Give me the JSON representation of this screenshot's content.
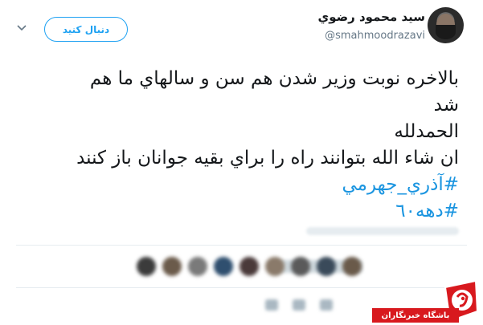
{
  "user": {
    "display_name": "سید محمود رضوي",
    "handle": "@smahmoodrazavi",
    "avatar_icon": "profile-photo"
  },
  "header": {
    "follow_label": "دنبال کنید",
    "caret_icon": "chevron-down-icon"
  },
  "tweet": {
    "line1": "بالاخره نوبت وزير شدن هم سن و سالهاي ما هم",
    "line2": "شد",
    "line3": "الحمدلله",
    "line4": "ان شاء الله بتوانند راه را براي بقيه جوانان باز كنند",
    "hashtag1": "#آذري_جهرمي",
    "hashtag2": "#دهه٦٠"
  },
  "watermark": {
    "label": "باشگاه خبرنگاران",
    "logo_icon": "yjc-logo"
  },
  "colors": {
    "accent": "#1da1f2",
    "hashtag": "#1b95e0",
    "text": "#14171a",
    "muted": "#657786",
    "watermark_red": "#d8191e"
  }
}
